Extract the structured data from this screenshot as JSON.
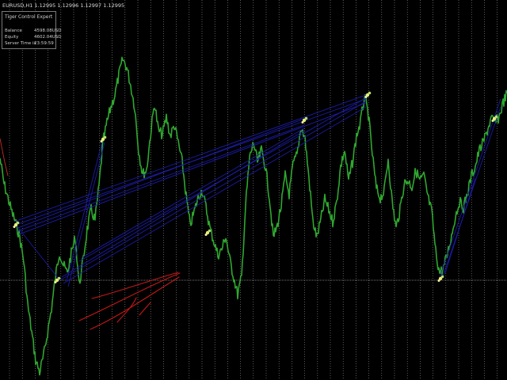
{
  "window": {
    "symbol_line": "EURUSD,H1  1.12995 1.12996 1.12997 1.12995"
  },
  "ea_panel": {
    "title": "Tiger Control Expert",
    "rows": [
      {
        "label": "Balance",
        "value": "4598.08USD"
      },
      {
        "label": "Equity",
        "value": "4602.04USD"
      },
      {
        "label": "Server Time is",
        "value": "23:59:59"
      }
    ]
  },
  "colors": {
    "background": "#000000",
    "grid": "#c8c8c8",
    "price": "#2fa82f",
    "trend_lines": "#1c1ca8",
    "signal_markers": "#ecec78",
    "hand_arrow": "#c41818",
    "price_level": "#9a9a9a"
  }
}
